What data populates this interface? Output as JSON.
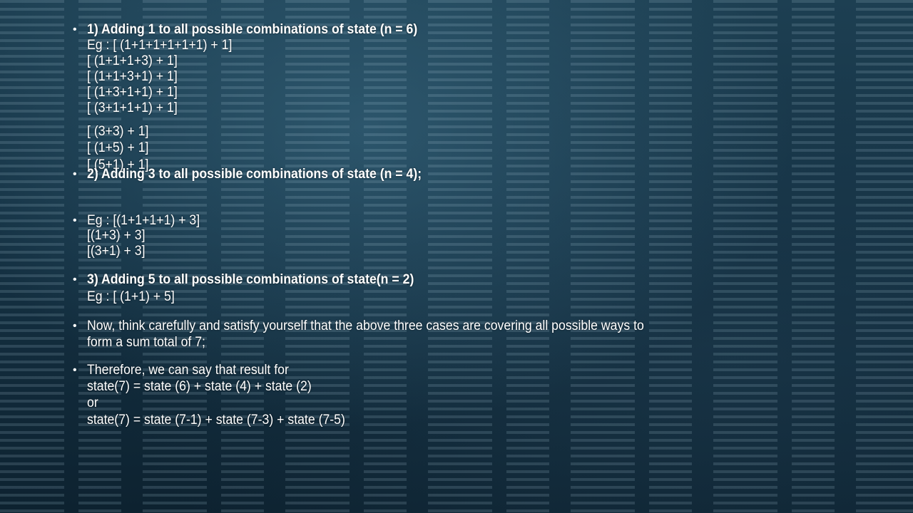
{
  "slide": {
    "case1": {
      "heading": "1) Adding 1 to all possible combinations of state (n = 6)",
      "examples": [
        "Eg : [ (1+1+1+1+1+1) + 1]",
        "[ (1+1+1+3) + 1]",
        "[ (1+1+3+1) + 1]",
        "[ (1+3+1+1) + 1]",
        "[ (3+1+1+1) + 1]",
        "[ (3+3) + 1]",
        "[ (1+5) + 1]",
        "[ (5+1) + 1]"
      ]
    },
    "case2": {
      "heading": "2) Adding 3 to all possible combinations of state (n = 4);",
      "examples": [
        "Eg : [(1+1+1+1) + 3]",
        "[(1+3) + 3]",
        "[(3+1) + 3]"
      ]
    },
    "case3": {
      "heading": "3) Adding 5 to all possible combinations of state(n = 2)",
      "examples": [
        "Eg : [ (1+1) + 5]"
      ]
    },
    "note": [
      "Now, think carefully and satisfy yourself that the above three cases are covering all possible ways to",
      "form a sum total of 7;"
    ],
    "conclusion": [
      "Therefore, we can say that result for",
      "state(7) = state (6) + state (4) + state (2)",
      "or",
      "state(7) = state (7-1) + state (7-3) + state (7-5)"
    ],
    "bullet_char": "•"
  }
}
